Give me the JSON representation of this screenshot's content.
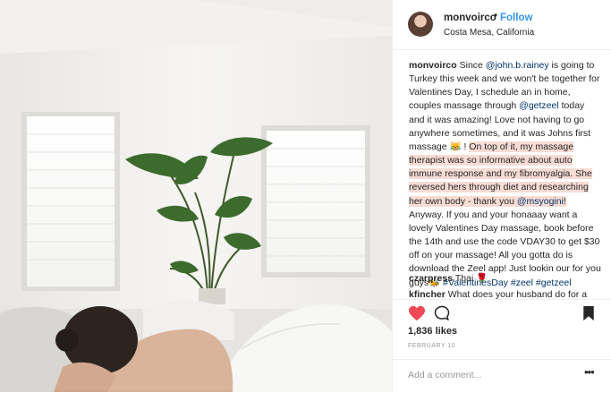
{
  "header": {
    "username": "monvoirco",
    "dot": "•",
    "follow_label": "Follow",
    "location": "Costa Mesa, California"
  },
  "caption": {
    "username": "monvoirco",
    "t1": " Since ",
    "m1": "@john.b.rainey",
    "t2": " is going to Turkey this week and we won't be together for Valentines Day, I schedule an in home, couples massage through ",
    "m2": "@getzeel",
    "t3": " today and it was amazing! Love not having to go anywhere sometimes, and it was Johns first massage 😹 ! ",
    "h1": "On top of it, my massage therapist was so informative about auto immune response and my fibromyalgia. She reversed hers through diet and researching her own body - thank you ",
    "m3": "@msyogini",
    "h2": "!",
    "t4": " Anyway. If you and your honaaay want a lovely Valentines Day massage, book before the 14th and use the code VDAY30 to get $30 off on your massage! All you gotta do is download the Zeel app! Just lookin our for you guys🐝 ",
    "tag1": "#ValentinesDay",
    "sp1": " ",
    "tag2": "#zeel",
    "sp2": " ",
    "tag3": "#getzeel"
  },
  "comments": [
    {
      "user": "czarpress",
      "text": " Thai ",
      "emoji": "🌹"
    },
    {
      "user": "kfincher",
      "text": " What does your husband do for a"
    }
  ],
  "actions": {
    "likes": "1,836 likes",
    "date": "FEBRUARY 10",
    "add_comment_placeholder": "Add a comment...",
    "more": "•••"
  },
  "colors": {
    "link": "#3897f0",
    "mention": "#003569",
    "highlight": "#f7dcd4",
    "like_red": "#ed4956"
  },
  "icons": [
    "avatar",
    "heart-icon",
    "comment-icon",
    "bookmark-icon",
    "more-options-icon"
  ]
}
